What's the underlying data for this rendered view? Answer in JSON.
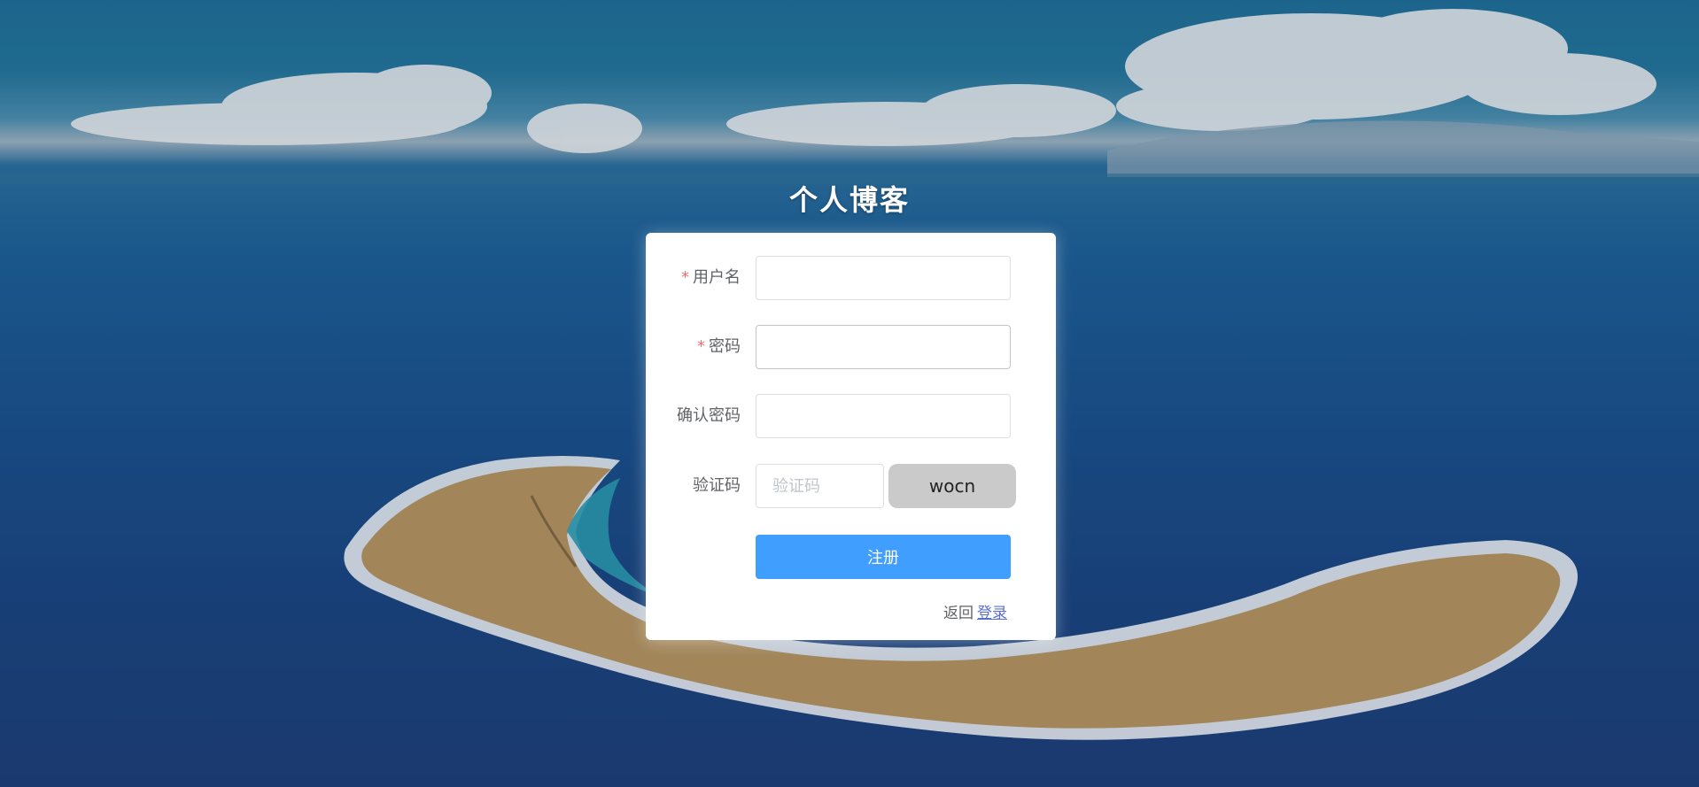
{
  "page": {
    "title": "个人博客"
  },
  "form": {
    "username": {
      "label": "用户名",
      "required": true,
      "value": ""
    },
    "password": {
      "label": "密码",
      "required": true,
      "value": ""
    },
    "confirm_password": {
      "label": "确认密码",
      "required": false,
      "value": ""
    },
    "captcha": {
      "label": "验证码",
      "placeholder": "验证码",
      "value": "",
      "code": "wocn"
    },
    "submit_label": "注册",
    "footer": {
      "prefix": "返回",
      "link_label": "登录"
    }
  },
  "colors": {
    "primary": "#409eff",
    "required_mark": "#f56c6c",
    "link": "#5b6fd0",
    "captcha_bg": "#cacaca"
  },
  "icons": {
    "required_mark": "*"
  }
}
